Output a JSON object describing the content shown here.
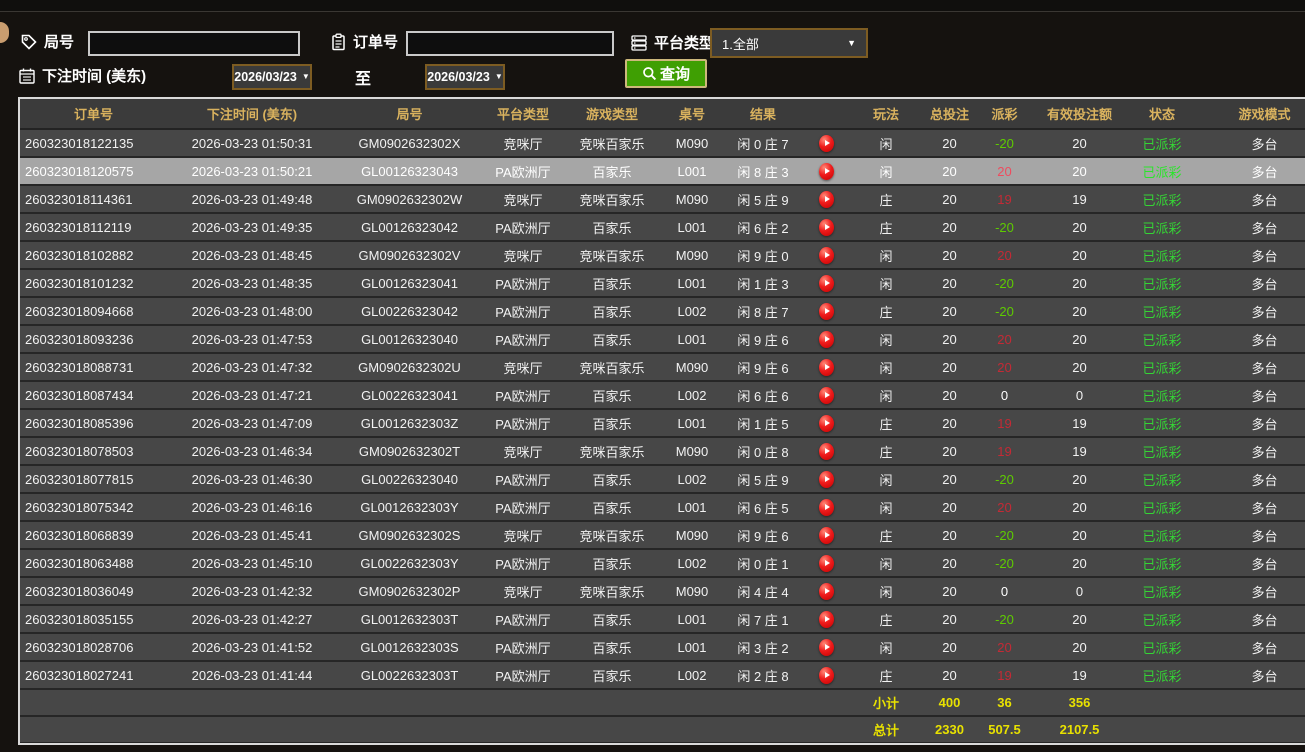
{
  "filters": {
    "round_label": "局号",
    "round_value": "",
    "order_label": "订单号",
    "order_value": "",
    "platform_label": "平台类型",
    "platform_value": "1.全部",
    "bet_time_label": "下注时间 (美东)",
    "date_from": "2026/03/23",
    "to_label": "至",
    "date_to": "2026/03/23",
    "query_label": "查询"
  },
  "icons": {
    "round": "tag-icon",
    "order": "clipboard-icon",
    "platform": "server-stack-icon",
    "bet_time": "calendar-icon",
    "query": "magnifier-icon",
    "result_play": "play-icon"
  },
  "colors": {
    "header_gold": "#d9b25e",
    "payout_win_red": "#c42a35",
    "payout_loss_green": "#5ecb00",
    "status_green": "#35d435",
    "totals_yellow": "#e8e100",
    "query_green": "#3f9f03",
    "picker_border": "#7d5c22",
    "row_bg": "#474747",
    "selected_row_bg": "#a6a6a6"
  },
  "table": {
    "headers": [
      "订单号",
      "下注时间 (美东)",
      "局号",
      "平台类型",
      "游戏类型",
      "桌号",
      "结果",
      "",
      "玩法",
      "总投注",
      "派彩",
      "有效投注额",
      "状态",
      "游戏模式"
    ],
    "rows": [
      {
        "order": "260323018122135",
        "time": "2026-03-23 01:50:31",
        "round": "GM0902632302X",
        "platform": "竞咪厅",
        "game_type": "竞咪百家乐",
        "table_no": "M090",
        "result": "闲 0 庄 7",
        "play_type": "闲",
        "total_bet": "20",
        "payout": "-20",
        "payout_class": "neg",
        "valid_bet": "20",
        "status": "已派彩",
        "mode": "多台"
      },
      {
        "order": "260323018120575",
        "time": "2026-03-23 01:50:21",
        "round": "GL00126323043",
        "platform": "PA欧洲厅",
        "game_type": "百家乐",
        "table_no": "L001",
        "result": "闲 8 庄 3",
        "play_type": "闲",
        "total_bet": "20",
        "payout": "20",
        "payout_class": "pos",
        "valid_bet": "20",
        "status": "已派彩",
        "mode": "多台",
        "selected": true
      },
      {
        "order": "260323018114361",
        "time": "2026-03-23 01:49:48",
        "round": "GM0902632302W",
        "platform": "竞咪厅",
        "game_type": "竞咪百家乐",
        "table_no": "M090",
        "result": "闲 5 庄 9",
        "play_type": "庄",
        "total_bet": "20",
        "payout": "19",
        "payout_class": "pos",
        "valid_bet": "19",
        "status": "已派彩",
        "mode": "多台"
      },
      {
        "order": "260323018112119",
        "time": "2026-03-23 01:49:35",
        "round": "GL00126323042",
        "platform": "PA欧洲厅",
        "game_type": "百家乐",
        "table_no": "L001",
        "result": "闲 6 庄 2",
        "play_type": "庄",
        "total_bet": "20",
        "payout": "-20",
        "payout_class": "neg",
        "valid_bet": "20",
        "status": "已派彩",
        "mode": "多台"
      },
      {
        "order": "260323018102882",
        "time": "2026-03-23 01:48:45",
        "round": "GM0902632302V",
        "platform": "竞咪厅",
        "game_type": "竞咪百家乐",
        "table_no": "M090",
        "result": "闲 9 庄 0",
        "play_type": "闲",
        "total_bet": "20",
        "payout": "20",
        "payout_class": "pos",
        "valid_bet": "20",
        "status": "已派彩",
        "mode": "多台"
      },
      {
        "order": "260323018101232",
        "time": "2026-03-23 01:48:35",
        "round": "GL00126323041",
        "platform": "PA欧洲厅",
        "game_type": "百家乐",
        "table_no": "L001",
        "result": "闲 1 庄 3",
        "play_type": "闲",
        "total_bet": "20",
        "payout": "-20",
        "payout_class": "neg",
        "valid_bet": "20",
        "status": "已派彩",
        "mode": "多台"
      },
      {
        "order": "260323018094668",
        "time": "2026-03-23 01:48:00",
        "round": "GL00226323042",
        "platform": "PA欧洲厅",
        "game_type": "百家乐",
        "table_no": "L002",
        "result": "闲 8 庄 7",
        "play_type": "庄",
        "total_bet": "20",
        "payout": "-20",
        "payout_class": "neg",
        "valid_bet": "20",
        "status": "已派彩",
        "mode": "多台"
      },
      {
        "order": "260323018093236",
        "time": "2026-03-23 01:47:53",
        "round": "GL00126323040",
        "platform": "PA欧洲厅",
        "game_type": "百家乐",
        "table_no": "L001",
        "result": "闲 9 庄 6",
        "play_type": "闲",
        "total_bet": "20",
        "payout": "20",
        "payout_class": "pos",
        "valid_bet": "20",
        "status": "已派彩",
        "mode": "多台"
      },
      {
        "order": "260323018088731",
        "time": "2026-03-23 01:47:32",
        "round": "GM0902632302U",
        "platform": "竞咪厅",
        "game_type": "竞咪百家乐",
        "table_no": "M090",
        "result": "闲 9 庄 6",
        "play_type": "闲",
        "total_bet": "20",
        "payout": "20",
        "payout_class": "pos",
        "valid_bet": "20",
        "status": "已派彩",
        "mode": "多台"
      },
      {
        "order": "260323018087434",
        "time": "2026-03-23 01:47:21",
        "round": "GL00226323041",
        "platform": "PA欧洲厅",
        "game_type": "百家乐",
        "table_no": "L002",
        "result": "闲 6 庄 6",
        "play_type": "闲",
        "total_bet": "20",
        "payout": "0",
        "payout_class": "zero",
        "valid_bet": "0",
        "status": "已派彩",
        "mode": "多台"
      },
      {
        "order": "260323018085396",
        "time": "2026-03-23 01:47:09",
        "round": "GL0012632303Z",
        "platform": "PA欧洲厅",
        "game_type": "百家乐",
        "table_no": "L001",
        "result": "闲 1 庄 5",
        "play_type": "庄",
        "total_bet": "20",
        "payout": "19",
        "payout_class": "pos",
        "valid_bet": "19",
        "status": "已派彩",
        "mode": "多台"
      },
      {
        "order": "260323018078503",
        "time": "2026-03-23 01:46:34",
        "round": "GM0902632302T",
        "platform": "竞咪厅",
        "game_type": "竞咪百家乐",
        "table_no": "M090",
        "result": "闲 0 庄 8",
        "play_type": "庄",
        "total_bet": "20",
        "payout": "19",
        "payout_class": "pos",
        "valid_bet": "19",
        "status": "已派彩",
        "mode": "多台"
      },
      {
        "order": "260323018077815",
        "time": "2026-03-23 01:46:30",
        "round": "GL00226323040",
        "platform": "PA欧洲厅",
        "game_type": "百家乐",
        "table_no": "L002",
        "result": "闲 5 庄 9",
        "play_type": "闲",
        "total_bet": "20",
        "payout": "-20",
        "payout_class": "neg",
        "valid_bet": "20",
        "status": "已派彩",
        "mode": "多台"
      },
      {
        "order": "260323018075342",
        "time": "2026-03-23 01:46:16",
        "round": "GL0012632303Y",
        "platform": "PA欧洲厅",
        "game_type": "百家乐",
        "table_no": "L001",
        "result": "闲 6 庄 5",
        "play_type": "闲",
        "total_bet": "20",
        "payout": "20",
        "payout_class": "pos",
        "valid_bet": "20",
        "status": "已派彩",
        "mode": "多台"
      },
      {
        "order": "260323018068839",
        "time": "2026-03-23 01:45:41",
        "round": "GM0902632302S",
        "platform": "竞咪厅",
        "game_type": "竞咪百家乐",
        "table_no": "M090",
        "result": "闲 9 庄 6",
        "play_type": "庄",
        "total_bet": "20",
        "payout": "-20",
        "payout_class": "neg",
        "valid_bet": "20",
        "status": "已派彩",
        "mode": "多台"
      },
      {
        "order": "260323018063488",
        "time": "2026-03-23 01:45:10",
        "round": "GL0022632303Y",
        "platform": "PA欧洲厅",
        "game_type": "百家乐",
        "table_no": "L002",
        "result": "闲 0 庄 1",
        "play_type": "闲",
        "total_bet": "20",
        "payout": "-20",
        "payout_class": "neg",
        "valid_bet": "20",
        "status": "已派彩",
        "mode": "多台"
      },
      {
        "order": "260323018036049",
        "time": "2026-03-23 01:42:32",
        "round": "GM0902632302P",
        "platform": "竞咪厅",
        "game_type": "竞咪百家乐",
        "table_no": "M090",
        "result": "闲 4 庄 4",
        "play_type": "闲",
        "total_bet": "20",
        "payout": "0",
        "payout_class": "zero",
        "valid_bet": "0",
        "status": "已派彩",
        "mode": "多台"
      },
      {
        "order": "260323018035155",
        "time": "2026-03-23 01:42:27",
        "round": "GL0012632303T",
        "platform": "PA欧洲厅",
        "game_type": "百家乐",
        "table_no": "L001",
        "result": "闲 7 庄 1",
        "play_type": "庄",
        "total_bet": "20",
        "payout": "-20",
        "payout_class": "neg",
        "valid_bet": "20",
        "status": "已派彩",
        "mode": "多台"
      },
      {
        "order": "260323018028706",
        "time": "2026-03-23 01:41:52",
        "round": "GL0012632303S",
        "platform": "PA欧洲厅",
        "game_type": "百家乐",
        "table_no": "L001",
        "result": "闲 3 庄 2",
        "play_type": "闲",
        "total_bet": "20",
        "payout": "20",
        "payout_class": "pos",
        "valid_bet": "20",
        "status": "已派彩",
        "mode": "多台"
      },
      {
        "order": "260323018027241",
        "time": "2026-03-23 01:41:44",
        "round": "GL0022632303T",
        "platform": "PA欧洲厅",
        "game_type": "百家乐",
        "table_no": "L002",
        "result": "闲 2 庄 8",
        "play_type": "庄",
        "total_bet": "20",
        "payout": "19",
        "payout_class": "pos",
        "valid_bet": "19",
        "status": "已派彩",
        "mode": "多台"
      }
    ],
    "subtotal": {
      "label": "小计",
      "total_bet": "400",
      "payout": "36",
      "valid_bet": "356"
    },
    "grand_total": {
      "label": "总计",
      "total_bet": "2330",
      "payout": "507.5",
      "valid_bet": "2107.5"
    }
  }
}
